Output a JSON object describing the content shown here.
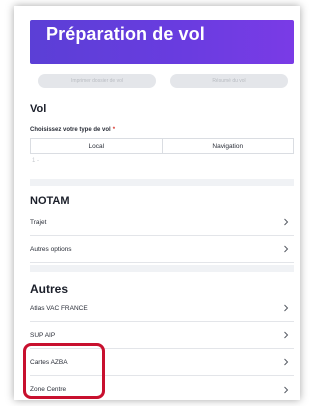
{
  "header": {
    "title": "Préparation de vol",
    "color": "#6a3ce0"
  },
  "top_buttons": [
    "Imprimer dossier de vol",
    "Résumé du vol"
  ],
  "vol": {
    "title": "Vol",
    "type_label": "Choisissez votre type de vol",
    "required_mark": "*",
    "options": [
      "Local",
      "Navigation"
    ],
    "hint": "1 -"
  },
  "notam": {
    "title": "NOTAM",
    "items": [
      "Trajet",
      "Autres options"
    ]
  },
  "autres": {
    "title": "Autres",
    "items": [
      "Atlas VAC FRANCE",
      "SUP AIP",
      "Cartes AZBA",
      "Zone Centre"
    ]
  },
  "highlight_color": "#c8102e",
  "icons": {
    "row_chevron": "chevron-right-icon"
  }
}
